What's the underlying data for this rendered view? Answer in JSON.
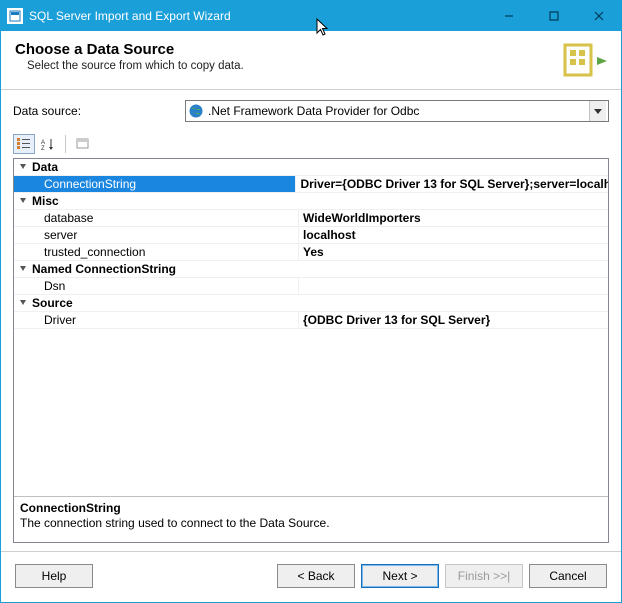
{
  "window": {
    "title": "SQL Server Import and Export Wizard"
  },
  "header": {
    "heading": "Choose a Data Source",
    "subtitle": "Select the source from which to copy data."
  },
  "data_source": {
    "label": "Data source:",
    "selected": ".Net Framework Data Provider for Odbc"
  },
  "property_grid": {
    "categories": [
      {
        "name": "Data",
        "items": [
          {
            "name": "ConnectionString",
            "value": "Driver={ODBC Driver 13 for SQL Server};server=localh",
            "bold": true,
            "selected": true
          }
        ]
      },
      {
        "name": "Misc",
        "items": [
          {
            "name": "database",
            "value": "WideWorldImporters",
            "bold": true
          },
          {
            "name": "server",
            "value": "localhost",
            "bold": true
          },
          {
            "name": "trusted_connection",
            "value": "Yes",
            "bold": true
          }
        ]
      },
      {
        "name": "Named ConnectionString",
        "items": [
          {
            "name": "Dsn",
            "value": ""
          }
        ]
      },
      {
        "name": "Source",
        "items": [
          {
            "name": "Driver",
            "value": "{ODBC Driver 13 for SQL Server}",
            "bold": true
          }
        ]
      }
    ],
    "description": {
      "title": "ConnectionString",
      "text": "The connection string used to connect to the Data Source."
    }
  },
  "footer": {
    "help": "Help",
    "back": "< Back",
    "next": "Next >",
    "finish": "Finish >>|",
    "cancel": "Cancel"
  }
}
